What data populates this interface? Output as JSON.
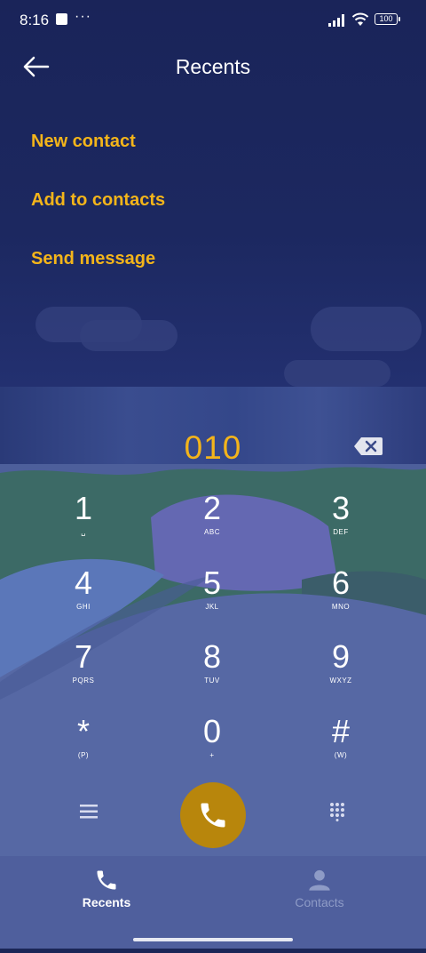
{
  "status_bar": {
    "time": "8:16",
    "dots": "···",
    "battery": "100"
  },
  "header": {
    "title": "Recents",
    "back_icon": "arrow-left-icon"
  },
  "menu": [
    {
      "label": "New contact"
    },
    {
      "label": "Add to contacts"
    },
    {
      "label": "Send message"
    }
  ],
  "colors": {
    "accent": "#f4b51a",
    "call_button": "#b8860c",
    "background": "#1b2657"
  },
  "dialer": {
    "number": "010",
    "keys": [
      {
        "digit": "1",
        "letters": "␣"
      },
      {
        "digit": "2",
        "letters": "ABC"
      },
      {
        "digit": "3",
        "letters": "DEF"
      },
      {
        "digit": "4",
        "letters": "GHI"
      },
      {
        "digit": "5",
        "letters": "JKL"
      },
      {
        "digit": "6",
        "letters": "MNO"
      },
      {
        "digit": "7",
        "letters": "PQRS"
      },
      {
        "digit": "8",
        "letters": "TUV"
      },
      {
        "digit": "9",
        "letters": "WXYZ"
      },
      {
        "digit": "*",
        "letters": "(P)"
      },
      {
        "digit": "0",
        "letters": "+"
      },
      {
        "digit": "#",
        "letters": "(W)"
      }
    ]
  },
  "bottom_nav": {
    "tabs": [
      {
        "label": "Recents",
        "icon": "phone-icon",
        "active": true
      },
      {
        "label": "Contacts",
        "icon": "person-icon",
        "active": false
      }
    ]
  }
}
